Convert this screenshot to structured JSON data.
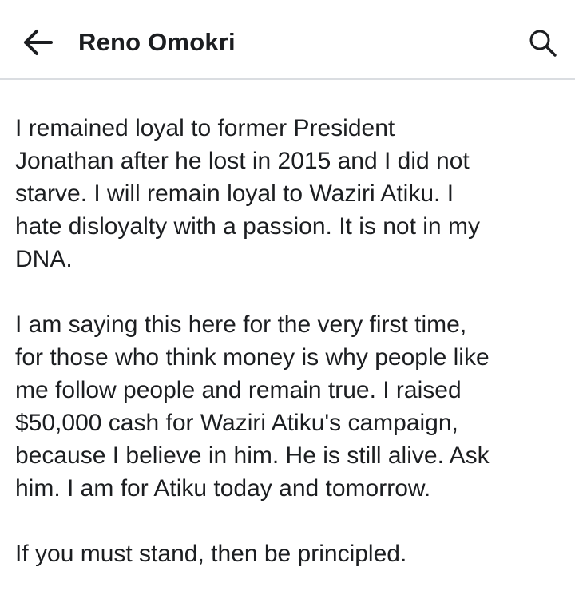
{
  "header": {
    "title": "Reno Omokri",
    "back_icon": "arrow-left-icon",
    "search_icon": "search-icon"
  },
  "post": {
    "paragraphs": [
      "I remained loyal to former President\nJonathan after he lost in 2015 and I did not\nstarve. I will remain loyal to Waziri Atiku. I\nhate disloyalty with a passion. It is not in my\nDNA.",
      "I am saying this here for the very first time,\nfor those who think money is why people like\nme follow people and remain true. I raised\n$50,000 cash for Waziri Atiku's campaign,\nbecause I believe in him. He is still alive. Ask\nhim. I am for Atiku today and tomorrow.",
      "If you must stand, then be principled."
    ]
  },
  "colors": {
    "text": "#1c1e21",
    "divider": "#dadde1",
    "background": "#ffffff"
  }
}
